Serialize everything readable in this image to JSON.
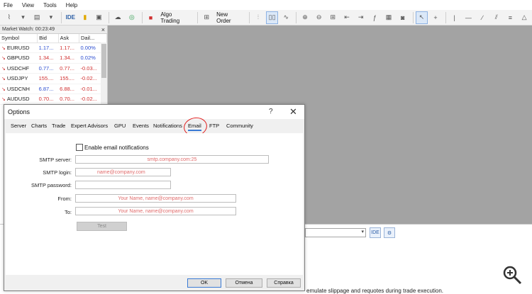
{
  "menu": [
    "File",
    "View",
    "Tools",
    "Help"
  ],
  "toolbar": {
    "ide_label": "IDE",
    "algo_trading_label": "Algo Trading",
    "new_order_label": "New Order"
  },
  "market_watch": {
    "title": "Market Watch: 00:23:49",
    "close_glyph": "×",
    "columns": [
      "Symbol",
      "Bid",
      "Ask",
      "Dail..."
    ],
    "rows": [
      {
        "symbol": "EURUSD",
        "bid": "1.17...",
        "ask": "1.17...",
        "daily": "0.00%"
      },
      {
        "symbol": "GBPUSD",
        "bid": "1.34...",
        "ask": "1.34...",
        "daily": "0.02%"
      },
      {
        "symbol": "USDCHF",
        "bid": "0.77...",
        "ask": "0.77...",
        "daily": "-0.03..."
      },
      {
        "symbol": "USDJPY",
        "bid": "155....",
        "ask": "155....",
        "daily": "-0.02..."
      },
      {
        "symbol": "USDCNH",
        "bid": "6.87...",
        "ask": "6.88...",
        "daily": "-0.01..."
      },
      {
        "symbol": "AUDUSD",
        "bid": "0.70...",
        "ask": "0.70...",
        "daily": "-0.02..."
      }
    ]
  },
  "dialog": {
    "title": "Options",
    "help_glyph": "?",
    "close_glyph": "✕",
    "tabs": [
      "Server",
      "Charts",
      "Trade",
      "Expert Advisors",
      "GPU",
      "Events",
      "Notifications",
      "Email",
      "FTP",
      "Community"
    ],
    "active_tab": "Email",
    "enable_label": "Enable email notifications",
    "fields": {
      "smtp_server": {
        "label": "SMTP server:",
        "placeholder": "smtp.company.com:25"
      },
      "smtp_login": {
        "label": "SMTP login:",
        "placeholder": "name@company.com"
      },
      "smtp_password": {
        "label": "SMTP password:",
        "placeholder": ""
      },
      "from": {
        "label": "From:",
        "placeholder": "Your Name, name@company.com"
      },
      "to": {
        "label": "To:",
        "placeholder": "Your Name, name@company.com"
      }
    },
    "test_label": "Test",
    "ok_label": "OK",
    "cancel_label": "Отмена",
    "help_label": "Справка"
  },
  "bottom": {
    "note": "emulate slippage and requotes during trade execution."
  },
  "colors": {
    "chart_bg": "#a3a3a3",
    "negative": "#d03030",
    "positive": "#2c4ed0",
    "placeholder": "#e06a6a",
    "annotation": "#e01e1e"
  }
}
